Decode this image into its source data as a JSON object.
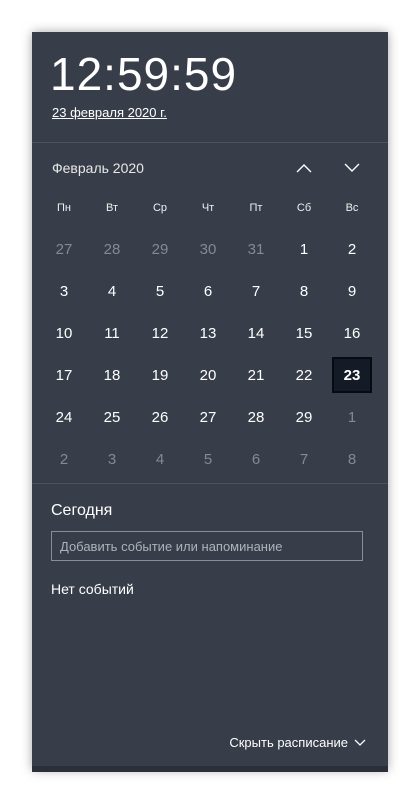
{
  "clock": {
    "time": "12:59:59",
    "date": "23 февраля 2020 г."
  },
  "calendar": {
    "month_label": "Февраль 2020",
    "weekdays": [
      "Пн",
      "Вт",
      "Ср",
      "Чт",
      "Пт",
      "Сб",
      "Вс"
    ],
    "days": [
      {
        "d": "27",
        "muted": true
      },
      {
        "d": "28",
        "muted": true
      },
      {
        "d": "29",
        "muted": true
      },
      {
        "d": "30",
        "muted": true
      },
      {
        "d": "31",
        "muted": true
      },
      {
        "d": "1"
      },
      {
        "d": "2"
      },
      {
        "d": "3"
      },
      {
        "d": "4"
      },
      {
        "d": "5"
      },
      {
        "d": "6"
      },
      {
        "d": "7"
      },
      {
        "d": "8"
      },
      {
        "d": "9"
      },
      {
        "d": "10"
      },
      {
        "d": "11"
      },
      {
        "d": "12"
      },
      {
        "d": "13"
      },
      {
        "d": "14"
      },
      {
        "d": "15"
      },
      {
        "d": "16"
      },
      {
        "d": "17"
      },
      {
        "d": "18"
      },
      {
        "d": "19"
      },
      {
        "d": "20"
      },
      {
        "d": "21"
      },
      {
        "d": "22"
      },
      {
        "d": "23",
        "today": true
      },
      {
        "d": "24"
      },
      {
        "d": "25"
      },
      {
        "d": "26"
      },
      {
        "d": "27"
      },
      {
        "d": "28"
      },
      {
        "d": "29"
      },
      {
        "d": "1",
        "muted": true
      },
      {
        "d": "2",
        "muted": true
      },
      {
        "d": "3",
        "muted": true
      },
      {
        "d": "4",
        "muted": true
      },
      {
        "d": "5",
        "muted": true
      },
      {
        "d": "6",
        "muted": true
      },
      {
        "d": "7",
        "muted": true
      },
      {
        "d": "8",
        "muted": true
      }
    ]
  },
  "agenda": {
    "title": "Сегодня",
    "input_placeholder": "Добавить событие или напоминание",
    "no_events": "Нет событий",
    "hide_label": "Скрыть расписание"
  },
  "icons": {
    "prev_month": "chevron-up-icon",
    "next_month": "chevron-down-icon",
    "hide_schedule": "chevron-down-icon"
  },
  "colors": {
    "panel_bg": "#383e49",
    "today_bg": "#141b27",
    "muted_text": "#838996"
  }
}
